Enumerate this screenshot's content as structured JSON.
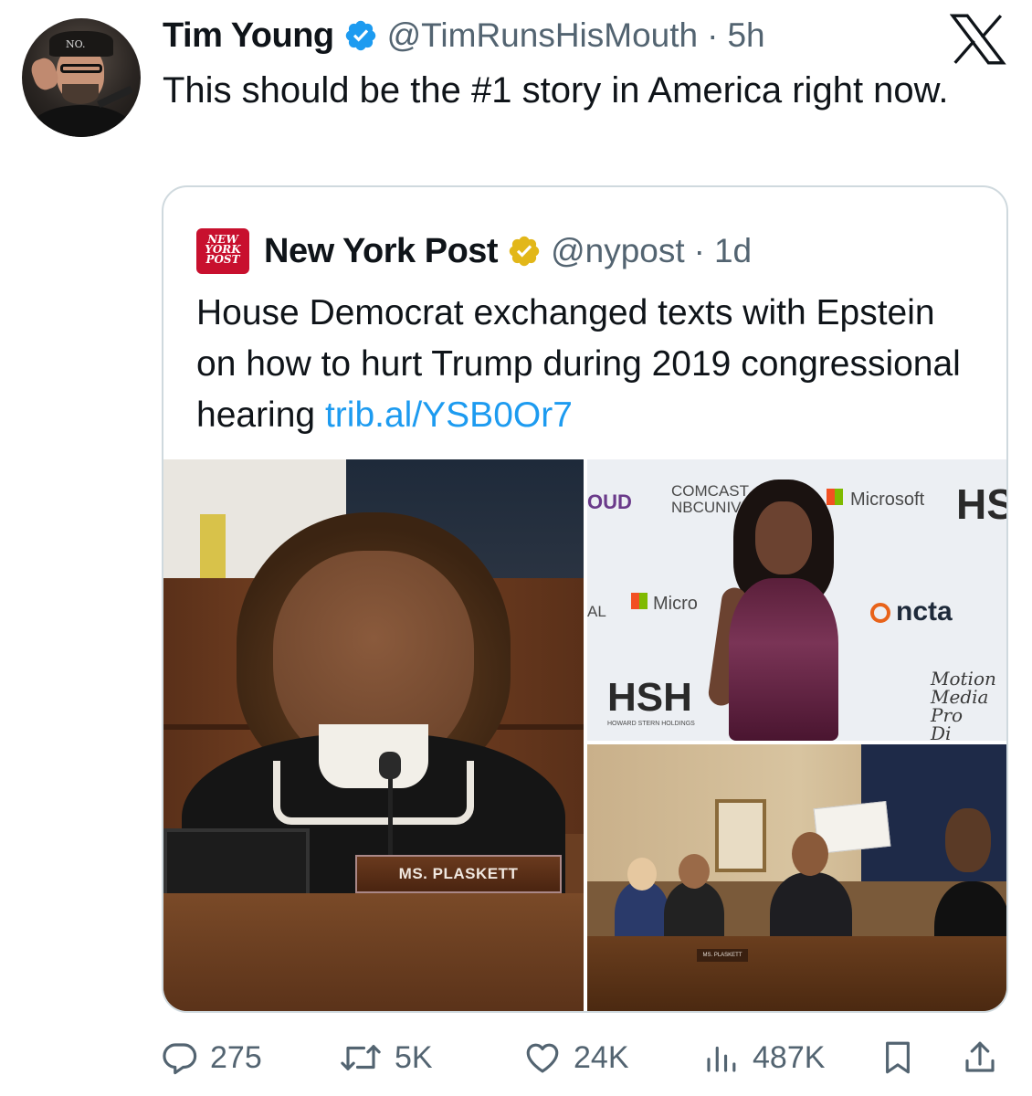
{
  "tweet": {
    "author_name": "Tim Young",
    "author_handle": "@TimRunsHisMouth",
    "separator": "·",
    "time": "5h",
    "text": "This should be the #1 story in America right now."
  },
  "quoted": {
    "logo_lines": [
      "NEW",
      "YORK",
      "POST"
    ],
    "author_name": "New York Post",
    "author_handle": "@nypost",
    "separator": "·",
    "time": "1d",
    "text": "House Democrat exchanged texts with Epstein on how to hurt Trump during 2019 congressional hearing",
    "link": "trib.al/YSB0Or7",
    "media": {
      "nameplate": "MS. PLASKETT",
      "backdrop_logos": [
        "COMCAST",
        "NBCUNIVERSAL",
        "Microsoft",
        "HSH",
        "ncta",
        "OUD",
        "AL",
        "Micro",
        "HOWARD STERN HOLDINGS"
      ],
      "backdrop_script": [
        "Motion",
        "Media Pro",
        "Di"
      ],
      "hearing_nameplate": "MS. PLASKETT"
    }
  },
  "actions": {
    "replies": "275",
    "reposts": "5K",
    "likes": "24K",
    "views": "487K"
  },
  "colors": {
    "text": "#0f1419",
    "secondary": "#536471",
    "link": "#1d9bf0",
    "verified_blue": "#1d9bf0",
    "verified_gold": "#e2b719",
    "border": "#cfd9de"
  }
}
